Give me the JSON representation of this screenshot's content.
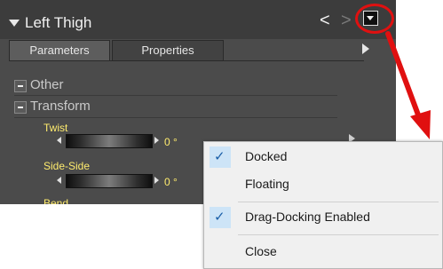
{
  "panel": {
    "title": "Left Thigh",
    "nav_prev": "<",
    "nav_next": ">",
    "tabs": [
      {
        "label": "Parameters",
        "active": true
      },
      {
        "label": "Properties",
        "active": false
      }
    ],
    "groups": [
      {
        "label": "Other"
      },
      {
        "label": "Transform"
      }
    ],
    "params": [
      {
        "label": "Twist",
        "value": "0 °"
      },
      {
        "label": "Side-Side",
        "value": "0 °"
      },
      {
        "label": "Bend"
      }
    ]
  },
  "menu": {
    "items": [
      {
        "label": "Docked",
        "checked": true
      },
      {
        "label": "Floating",
        "checked": false
      },
      {
        "label": "Drag-Docking Enabled",
        "checked": true
      },
      {
        "label": "Close",
        "checked": false
      }
    ],
    "check_glyph": "✓"
  },
  "annotation": {
    "color": "#e01010"
  },
  "colors": {
    "panel_bg": "#4b4b4b",
    "param_label": "#ffec6e",
    "menu_bg": "#f0f0f0",
    "check_highlight": "#cde4f7"
  }
}
